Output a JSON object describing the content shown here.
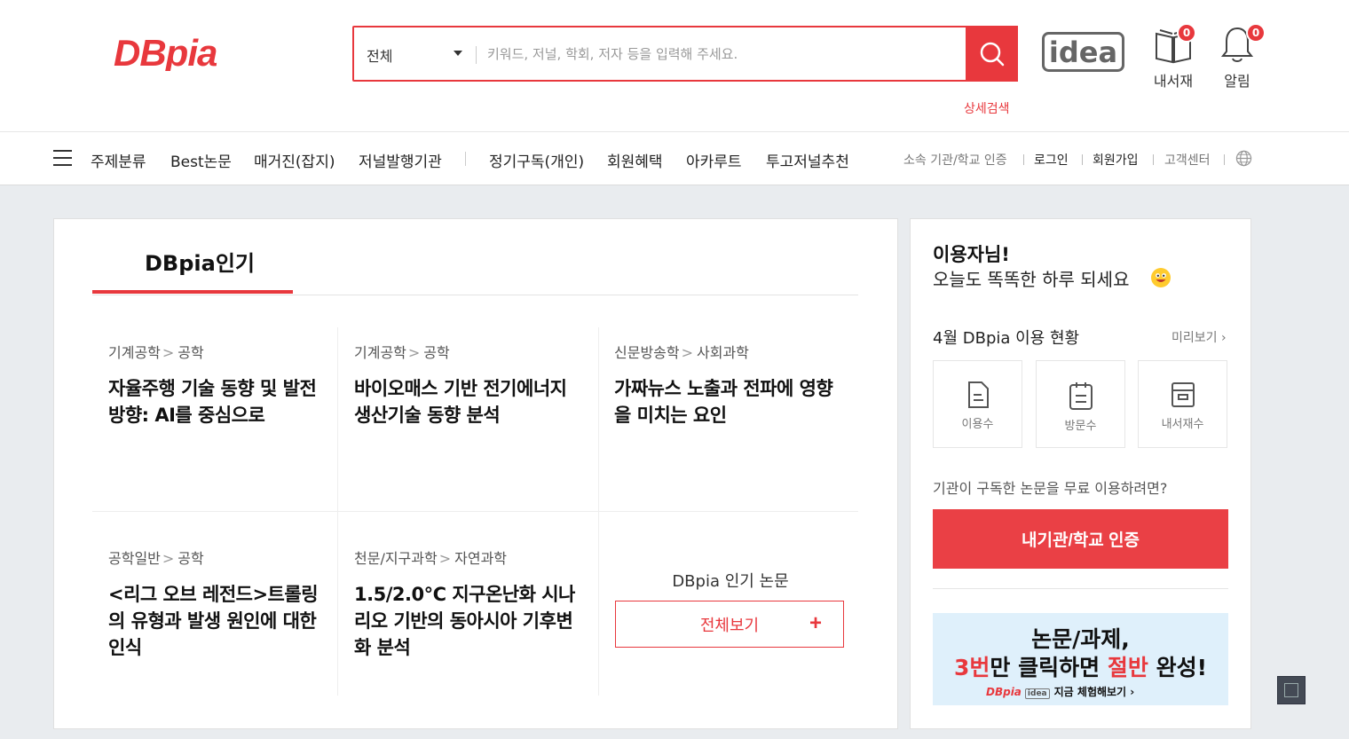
{
  "header": {
    "search": {
      "scope": "전체",
      "placeholder": "키워드, 저널, 학회, 저자 등을 입력해 주세요."
    },
    "detail_search": "상세검색",
    "library": {
      "label": "내서재",
      "count": "0"
    },
    "alarm": {
      "label": "알림",
      "count": "0"
    }
  },
  "nav": {
    "items": [
      "주제분류",
      "Best논문",
      "매거진(잡지)",
      "저널발행기관",
      "정기구독(개인)",
      "회원혜택",
      "아카루트",
      "투고저널추천"
    ],
    "util": [
      "소속 기관/학교 인증",
      "로그인",
      "회원가입",
      "고객센터"
    ]
  },
  "popular": {
    "title": "DBpia인기",
    "papers": [
      {
        "cat1": "기계공학",
        "cat2": "공학",
        "title": "자율주행 기술 동향 및 발전 방향: AI를 중심으로"
      },
      {
        "cat1": "기계공학",
        "cat2": "공학",
        "title": "바이오매스 기반 전기에너지 생산기술 동향 분석"
      },
      {
        "cat1": "신문방송학",
        "cat2": "사회과학",
        "title": "가짜뉴스 노출과 전파에 영향을 미치는 요인"
      },
      {
        "cat1": "공학일반",
        "cat2": "공학",
        "title": "<리그 오브 레전드>트롤링의 유형과 발생 원인에 대한 인식"
      },
      {
        "cat1": "천문/지구과학",
        "cat2": "자연과학",
        "title": "1.5/2.0℃ 지구온난화 시나리오 기반의 동아시아 기후변화 분석"
      }
    ],
    "more_label": "DBpia 인기 논문",
    "view_all": "전체보기"
  },
  "side": {
    "greeting1": "이용자님!",
    "greeting2": "오늘도 똑똑한 하루 되세요",
    "usage_title": "4월 DBpia 이용 현황",
    "preview": "미리보기",
    "stats": [
      {
        "label": "이용수",
        "icon": "document-icon"
      },
      {
        "label": "방문수",
        "icon": "clipboard-icon"
      },
      {
        "label": "내서재수",
        "icon": "archive-icon"
      }
    ],
    "institution_question": "기관이 구독한 논문을 무료 이용하려면?",
    "institution_button": "내기관/학교 인증",
    "banner": {
      "line1": "논문/과제,",
      "line2_a": "3번",
      "line2_b": "만 클릭하면 ",
      "line2_c": "절반",
      "line2_d": " 완성!",
      "cta": "지금 체험해보기"
    }
  },
  "colors": {
    "accent": "#e8383d"
  }
}
